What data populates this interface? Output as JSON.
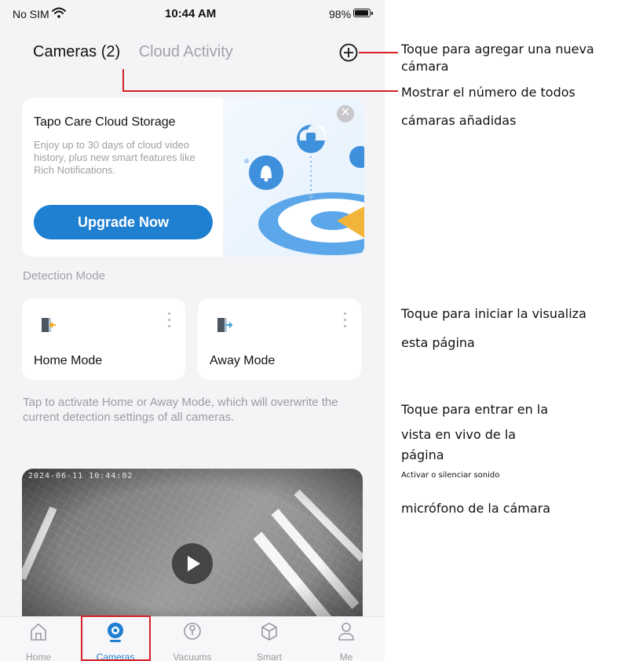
{
  "status_bar": {
    "carrier": "No SIM",
    "time": "10:44 AM",
    "battery": "98%"
  },
  "header": {
    "tab_cameras": "Cameras (2)",
    "tab_cloud": "Cloud Activity",
    "add_icon": "plus-circle-icon"
  },
  "promo": {
    "title": "Tapo Care Cloud Storage",
    "description": "Enjoy up to 30 days of cloud video history, plus new smart features like Rich Notifications.",
    "button": "Upgrade Now",
    "close_icon": "close-icon"
  },
  "detection": {
    "label": "Detection Mode",
    "modes": [
      {
        "label": "Home Mode",
        "icon": "home-mode-door-icon"
      },
      {
        "label": "Away Mode",
        "icon": "away-mode-door-icon"
      }
    ],
    "hint": "Tap to activate Home or Away Mode, which will overwrite the current detection settings of all cameras."
  },
  "camera": {
    "timestamp": "2024-06-11 10:44:02",
    "play_icon": "play-icon"
  },
  "bottom_nav": [
    {
      "label": "Home",
      "icon": "home-icon",
      "active": false
    },
    {
      "label": "Cameras",
      "icon": "camera-icon",
      "active": true
    },
    {
      "label": "Vacuums",
      "icon": "vacuum-icon",
      "active": false
    },
    {
      "label": "Smart",
      "icon": "cube-icon",
      "active": false
    },
    {
      "label": "Me",
      "icon": "person-icon",
      "active": false
    }
  ],
  "annotations": {
    "add_camera_1": "Toque para agregar una nueva",
    "add_camera_2": "cámara",
    "count_1": "Mostrar el número de todos",
    "count_2": "cámaras añadidas",
    "view_1": "Toque para iniciar la visualiza",
    "view_2": "esta página",
    "live_1": "Toque para entrar en la",
    "live_2": "vista en vivo de la",
    "live_3": "página",
    "sound": "Activar o silenciar sonido",
    "mic": "micrófono de la cámara"
  },
  "colors": {
    "accent": "#1f7fd0",
    "annotation_line": "#d61f26",
    "background": "#f4f4f6"
  }
}
